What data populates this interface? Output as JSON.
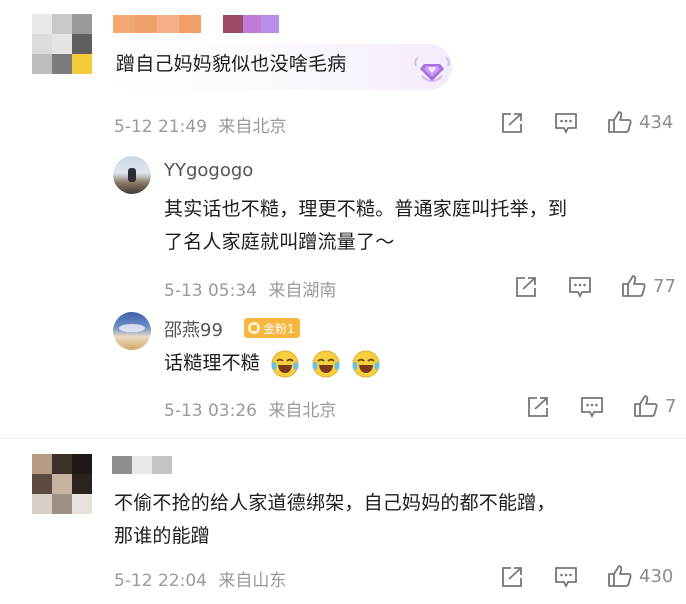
{
  "comments": [
    {
      "text": "蹭自己妈妈貌似也没啥毛病",
      "time": "5-12 21:49",
      "location": "来自北京",
      "likes": "434"
    },
    {
      "text": "不偷不抢的给人家道德绑架，自己妈妈的都不能蹭，那谁的能蹭",
      "line1": "不偷不抢的给人家道德绑架，自己妈妈的都不能蹭，",
      "line2": "那谁的能蹭",
      "time": "5-12 22:04",
      "location": "来自山东",
      "likes": "430"
    }
  ],
  "replies": [
    {
      "username": "YYgogogo",
      "line1": "其实话也不糙，理更不糙。普通家庭叫托举，到",
      "line2": "了名人家庭就叫蹭流量了～",
      "time": "5-13 05:34",
      "location": "来自湖南",
      "likes": "77"
    },
    {
      "username": "邵燕99",
      "badge": "金粉1",
      "text": "话糙理不糙",
      "emoji_count": 3,
      "time": "5-13 03:26",
      "location": "来自北京",
      "likes": "7"
    }
  ],
  "colors": {
    "name_blur_orange": "#f2a46a",
    "name_blur_purple": "#b88ee6",
    "badge_gold": "#f7b73e",
    "meta_gray": "#9a9a9a"
  }
}
